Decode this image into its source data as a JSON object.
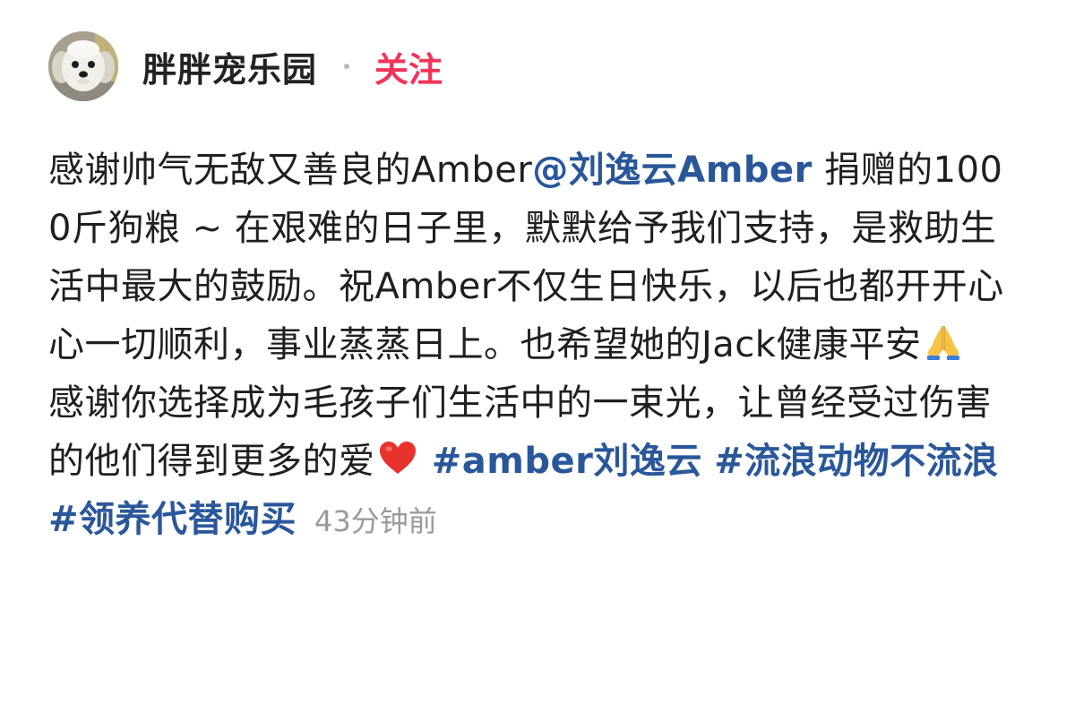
{
  "author": {
    "name": "胖胖宠乐园",
    "avatar_icon": "dog-avatar",
    "follow_label": "关注"
  },
  "post": {
    "p1_text1": "感谢帅气无敌又善良的Amber",
    "mention": "@刘逸云Amber",
    "p1_text2": " 捐赠的1000斤狗粮 ~ 在艰难的日子里，默默给予我们支持，是救助生活中最大的鼓励。祝Amber不仅生日快乐，以后也都开开心心一切顺利，事业蒸蒸日上。也希望她的Jack健康平安",
    "emoji_pray": "folded-hands-emoji",
    "p2_text": "感谢你选择成为毛孩子们生活中的一束光，让曾经受过伤害的他们得到更多的爱",
    "emoji_heart": "red-heart-emoji",
    "hashtags": [
      "#amber刘逸云",
      "#流浪动物不流浪",
      "#领养代替购买"
    ],
    "timestamp": "43分钟前"
  },
  "colors": {
    "link": "#2a579a",
    "follow": "#f0345a",
    "timestamp": "#9a9a9a"
  }
}
